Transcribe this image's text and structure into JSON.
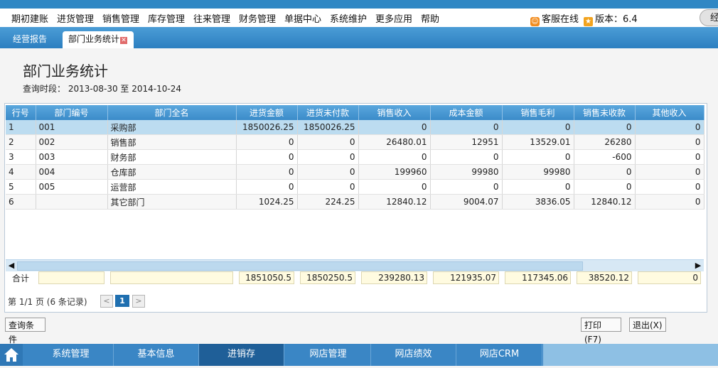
{
  "menu": {
    "items": [
      "期初建账",
      "进货管理",
      "销售管理",
      "库存管理",
      "往来管理",
      "财务管理",
      "单据中心",
      "系统维护",
      "更多应用",
      "帮助"
    ],
    "support": "客服在线",
    "version": "版本：6.4",
    "topright": "经"
  },
  "tabs": [
    {
      "label": "经营报告",
      "active": false
    },
    {
      "label": "部门业务统计",
      "active": true
    }
  ],
  "page": {
    "title": "部门业务统计",
    "period_label": "查询时段：",
    "start": "2013-08-30",
    "to": "至",
    "end": "2014-10-24"
  },
  "table": {
    "columns": [
      "行号",
      "部门编号",
      "部门全名",
      "进货金额",
      "进货未付款",
      "销售收入",
      "成本金额",
      "销售毛利",
      "销售未收款",
      "其他收入"
    ],
    "rows": [
      [
        "1",
        "001",
        "采购部",
        "1850026.25",
        "1850026.25",
        "0",
        "0",
        "0",
        "0",
        "0"
      ],
      [
        "2",
        "002",
        "销售部",
        "0",
        "0",
        "26480.01",
        "12951",
        "13529.01",
        "26280",
        "0"
      ],
      [
        "3",
        "003",
        "财务部",
        "0",
        "0",
        "0",
        "0",
        "0",
        "-600",
        "0"
      ],
      [
        "4",
        "004",
        "仓库部",
        "0",
        "0",
        "199960",
        "99980",
        "99980",
        "0",
        "0"
      ],
      [
        "5",
        "005",
        "运营部",
        "0",
        "0",
        "0",
        "0",
        "0",
        "0",
        "0"
      ],
      [
        "6",
        "",
        "其它部门",
        "1024.25",
        "224.25",
        "12840.12",
        "9004.07",
        "3836.05",
        "12840.12",
        "0"
      ]
    ],
    "selected_row": 0
  },
  "totals": {
    "label": "合计",
    "values": [
      "",
      "",
      "1851050.5",
      "1850250.5",
      "239280.13",
      "121935.07",
      "117345.06",
      "38520.12",
      "0"
    ]
  },
  "pager": {
    "text": "第 1/1 页 (6 条记录)",
    "prev": "<",
    "current": "1",
    "next": ">"
  },
  "buttons": {
    "query": "查询条件",
    "print": "打印(F7)",
    "exit": "退出(X)"
  },
  "bottom_nav": {
    "items": [
      "系统管理",
      "基本信息",
      "进销存",
      "网店管理",
      "网店绩效",
      "网店CRM"
    ],
    "active": 2
  },
  "icons": {
    "home": "home-icon",
    "support": "chat-icon",
    "version": "star-icon",
    "scroll_left": "triangle-left-icon",
    "scroll_right": "triangle-right-icon"
  },
  "colors": {
    "accent": "#2f87c4",
    "header": "#3b8bc9",
    "selected_row": "#bcdcf0",
    "active_nav": "#1f5f98"
  }
}
